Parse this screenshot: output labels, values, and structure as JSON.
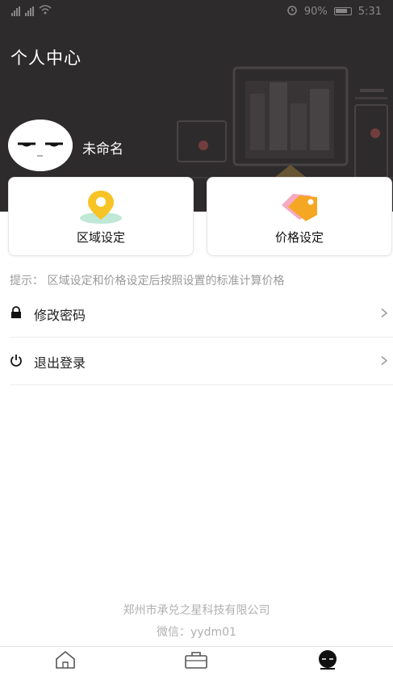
{
  "status_bar": {
    "left": "",
    "battery": "90%",
    "time": "5:31"
  },
  "header": {
    "title": "个人中心",
    "username": "未命名"
  },
  "cards": [
    {
      "label": "区域设定",
      "icon": "location-pin-icon"
    },
    {
      "label": "价格设定",
      "icon": "price-tag-icon"
    }
  ],
  "tip": "提示：  区域设定和价格设定后按照设置的标准计算价格",
  "menu": [
    {
      "label": "修改密码",
      "icon": "lock-icon"
    },
    {
      "label": "退出登录",
      "icon": "power-icon"
    }
  ],
  "footer": {
    "company": "郑州市承兑之星科技有限公司",
    "wechat": "微信：yydm01"
  },
  "tabbar": [
    {
      "name": "home",
      "icon": "home-icon",
      "active": false
    },
    {
      "name": "orders",
      "icon": "briefcase-icon",
      "active": false
    },
    {
      "name": "profile",
      "icon": "profile-icon",
      "active": true
    }
  ],
  "colors": {
    "header_bg": "#2e2b2c",
    "accent_yellow": "#f7c325",
    "tag_pink": "#f06a8a",
    "tag_orange": "#f5a623"
  }
}
